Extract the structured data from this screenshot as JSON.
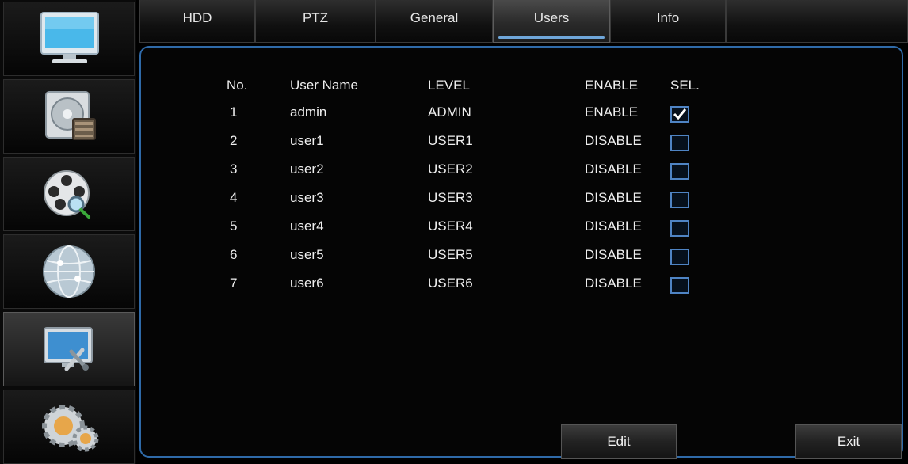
{
  "sidebar": {
    "items": [
      {
        "icon": "monitor-icon"
      },
      {
        "icon": "disk-record-icon"
      },
      {
        "icon": "film-reel-search-icon"
      },
      {
        "icon": "network-globe-icon"
      },
      {
        "icon": "system-tools-icon",
        "active": true
      },
      {
        "icon": "gears-icon"
      }
    ]
  },
  "tabs": [
    {
      "label": "HDD"
    },
    {
      "label": "PTZ"
    },
    {
      "label": "General"
    },
    {
      "label": "Users",
      "active": true
    },
    {
      "label": "Info"
    }
  ],
  "table": {
    "headers": {
      "no": "No.",
      "username": "User Name",
      "level": "LEVEL",
      "enable": "ENABLE",
      "sel": "SEL."
    },
    "rows": [
      {
        "no": "1",
        "username": "admin",
        "level": "ADMIN",
        "status": "ENABLE",
        "checked": true
      },
      {
        "no": "2",
        "username": "user1",
        "level": "USER1",
        "status": "DISABLE",
        "checked": false
      },
      {
        "no": "3",
        "username": "user2",
        "level": "USER2",
        "status": "DISABLE",
        "checked": false
      },
      {
        "no": "4",
        "username": "user3",
        "level": "USER3",
        "status": "DISABLE",
        "checked": false
      },
      {
        "no": "5",
        "username": "user4",
        "level": "USER4",
        "status": "DISABLE",
        "checked": false
      },
      {
        "no": "6",
        "username": "user5",
        "level": "USER5",
        "status": "DISABLE",
        "checked": false
      },
      {
        "no": "7",
        "username": "user6",
        "level": "USER6",
        "status": "DISABLE",
        "checked": false
      }
    ]
  },
  "buttons": {
    "edit": "Edit",
    "exit": "Exit"
  },
  "colors": {
    "accent": "#2f6aa8",
    "checkbox": "#4f84c4",
    "text": "#f0f0f0"
  }
}
